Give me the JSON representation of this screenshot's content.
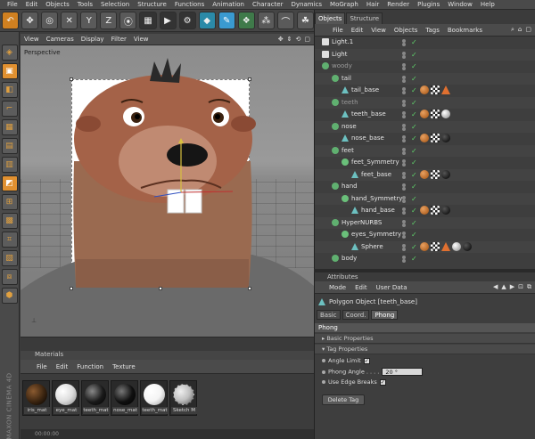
{
  "menubar": [
    "File",
    "Edit",
    "Objects",
    "Tools",
    "Selection",
    "Structure",
    "Functions",
    "Animation",
    "Character",
    "Dynamics",
    "MoGraph",
    "Hair",
    "Render",
    "Plugins",
    "Window",
    "Help"
  ],
  "toolbar": {
    "buttons": [
      "undo-icon",
      "move-icon",
      "select-icon",
      "x-axis-icon",
      "y-axis-icon",
      "z-axis-icon",
      "world-icon",
      "render-region-icon",
      "render-view-icon",
      "render-settings-icon",
      "cube-icon",
      "pen-icon",
      "subdivision-icon",
      "array-icon",
      "sky-icon",
      "bend-icon",
      "scene-icon",
      "camera-icon",
      "light-icon"
    ]
  },
  "left_strip": {
    "brand": "MAXON  CINEMA 4D"
  },
  "viewport": {
    "menu": [
      "View",
      "Cameras",
      "Display",
      "Filter",
      "View"
    ],
    "label": "Perspective"
  },
  "materials": {
    "title": "Materials",
    "menu": [
      "File",
      "Edit",
      "Function",
      "Texture"
    ],
    "items": [
      {
        "name": "iris_mat",
        "color": "#3a2410"
      },
      {
        "name": "eye_mat",
        "color": "#f0f0f0"
      },
      {
        "name": "teeth_mat",
        "color": "#1a1a1a"
      },
      {
        "name": "nose_mat",
        "color": "#101010"
      },
      {
        "name": "teeth_mat",
        "color": "#f4f4f4"
      },
      {
        "name": "Sketch M",
        "color": "#bfbfbf"
      }
    ],
    "time": "00:00:00"
  },
  "objects": {
    "tabs": [
      "Objects",
      "Structure"
    ],
    "menu": [
      "File",
      "Edit",
      "View",
      "Objects",
      "Tags",
      "Bookmarks"
    ],
    "rows": [
      {
        "name": "Light.1",
        "indent": 0,
        "kind": "light",
        "dim": false,
        "tags": []
      },
      {
        "name": "Light",
        "indent": 0,
        "kind": "light",
        "dim": false,
        "tags": []
      },
      {
        "name": "woody",
        "indent": 0,
        "kind": "null",
        "dim": true,
        "tags": []
      },
      {
        "name": "tail",
        "indent": 1,
        "kind": "null",
        "dim": false,
        "tags": []
      },
      {
        "name": "tail_base",
        "indent": 2,
        "kind": "poly",
        "dim": false,
        "tags": [
          "phong",
          "check",
          "tri"
        ]
      },
      {
        "name": "teeth",
        "indent": 1,
        "kind": "null",
        "dim": true,
        "tags": []
      },
      {
        "name": "teeth_base",
        "indent": 2,
        "kind": "poly",
        "dim": false,
        "tags": [
          "phong",
          "check",
          "ball-w"
        ]
      },
      {
        "name": "nose",
        "indent": 1,
        "kind": "null",
        "dim": false,
        "tags": []
      },
      {
        "name": "nose_base",
        "indent": 2,
        "kind": "poly",
        "dim": false,
        "tags": [
          "phong",
          "check",
          "ball-b"
        ]
      },
      {
        "name": "feet",
        "indent": 1,
        "kind": "null",
        "dim": false,
        "tags": []
      },
      {
        "name": "feet_Symmetry",
        "indent": 2,
        "kind": "sym",
        "dim": false,
        "tags": []
      },
      {
        "name": "feet_base",
        "indent": 3,
        "kind": "poly",
        "dim": false,
        "tags": [
          "phong",
          "check",
          "ball-b"
        ]
      },
      {
        "name": "hand",
        "indent": 1,
        "kind": "null",
        "dim": false,
        "tags": []
      },
      {
        "name": "hand_Symmetry",
        "indent": 2,
        "kind": "sym",
        "dim": false,
        "tags": []
      },
      {
        "name": "hand_base",
        "indent": 3,
        "kind": "poly",
        "dim": false,
        "tags": [
          "phong",
          "check",
          "ball-b"
        ]
      },
      {
        "name": "HyperNURBS",
        "indent": 1,
        "kind": "null",
        "dim": false,
        "tags": []
      },
      {
        "name": "eyes_Symmetry",
        "indent": 2,
        "kind": "sym",
        "dim": false,
        "tags": []
      },
      {
        "name": "Sphere",
        "indent": 3,
        "kind": "poly",
        "dim": false,
        "tags": [
          "phong",
          "check",
          "tri",
          "ball-w",
          "ball-b"
        ]
      },
      {
        "name": "body",
        "indent": 1,
        "kind": "null",
        "dim": false,
        "tags": []
      }
    ]
  },
  "attributes": {
    "title": "Attributes",
    "menu": [
      "Mode",
      "Edit",
      "User Data"
    ],
    "object_type": "Polygon Object [teeth_base]",
    "tabs": [
      "Basic",
      "Coord.",
      "Phong"
    ],
    "active_tab": "Phong",
    "header": "Phong",
    "sections": [
      "Basic Properties",
      "Tag Properties"
    ],
    "props": {
      "angle_limit": "Angle Limit",
      "phong_angle": "Phong Angle . . . .",
      "phong_angle_value": "20 °",
      "use_edge_breaks": "Use Edge Breaks"
    },
    "delete_tag": "Delete Tag"
  },
  "colors": {
    "accent": "#e09030",
    "check": "#5fd06a",
    "bg": "#3c3c3c"
  }
}
